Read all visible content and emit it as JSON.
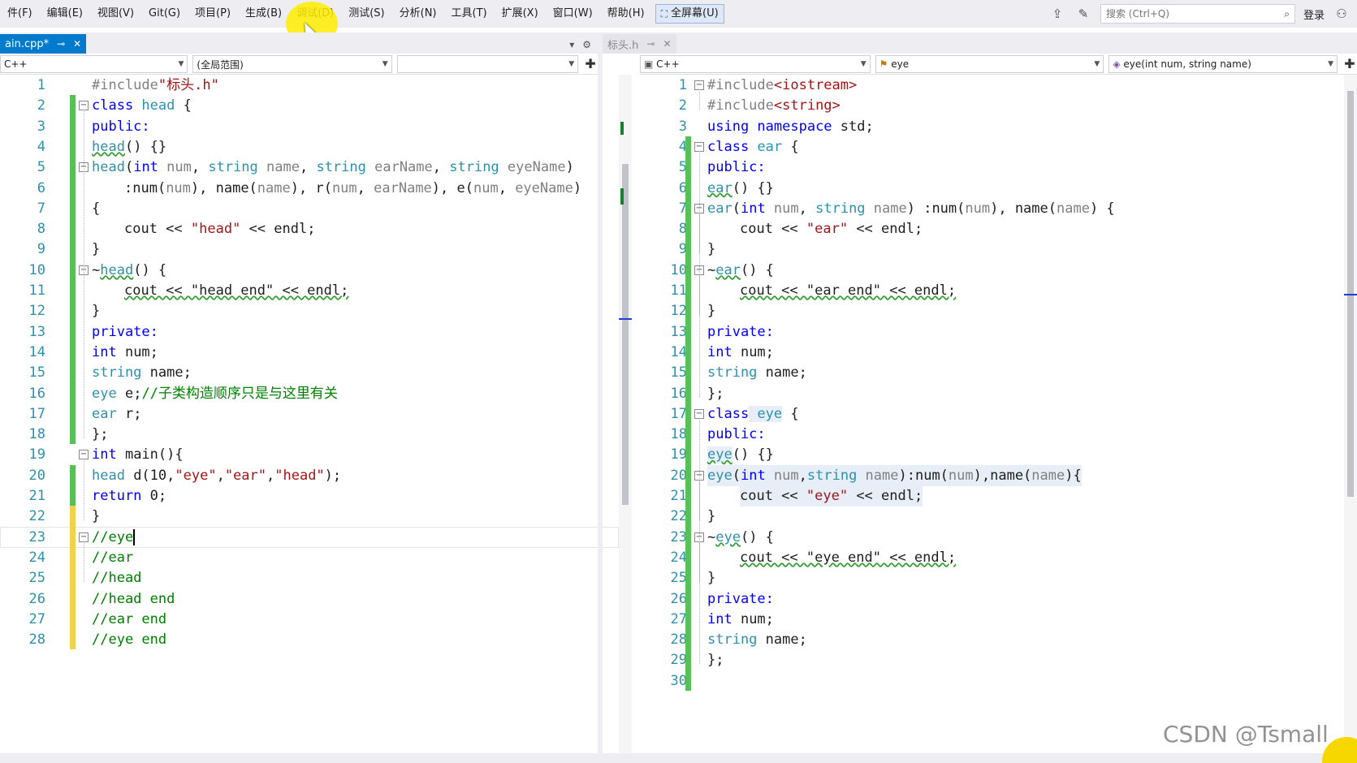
{
  "menubar": {
    "items": [
      "件(F)",
      "编辑(E)",
      "视图(V)",
      "Git(G)",
      "项目(P)",
      "生成(B)",
      "调试(D)",
      "测试(S)",
      "分析(N)",
      "工具(T)",
      "扩展(X)",
      "窗口(W)",
      "帮助(H)"
    ],
    "fullscreen": "全屏幕(U)",
    "search_placeholder": "搜索 (Ctrl+Q)",
    "login": "登录"
  },
  "left": {
    "tab": "ain.cpp*",
    "nav_lang": "C++",
    "nav_scope": "(全局范围)",
    "nav_member": ""
  },
  "right": {
    "tab": "标头.h",
    "nav_lang": "C++",
    "nav_scope": "eye",
    "nav_member": "eye(int num, string name)"
  },
  "left_lines": [
    "1",
    "2",
    "3",
    "4",
    "5",
    "6",
    "7",
    "8",
    "9",
    "10",
    "11",
    "12",
    "13",
    "14",
    "15",
    "16",
    "17",
    "18",
    "19",
    "20",
    "21",
    "22",
    "23",
    "24",
    "25",
    "26",
    "27",
    "28"
  ],
  "right_lines": [
    "1",
    "2",
    "3",
    "4",
    "5",
    "6",
    "7",
    "8",
    "9",
    "10",
    "11",
    "12",
    "13",
    "14",
    "15",
    "16",
    "17",
    "18",
    "19",
    "20",
    "21",
    "22",
    "23",
    "24",
    "25",
    "26",
    "27",
    "28",
    "29",
    "30"
  ],
  "left_code": {
    "l1a": "#include",
    "l1b": "\"标头.h\"",
    "l2a": "class",
    "l2b": " head",
    "l2c": " {",
    "l3": "public:",
    "l4a": "head",
    "l4b": "() {}",
    "l5a": "head",
    "l5b": "(",
    "l5c": "int",
    "l5d": " num",
    "l5e": ", ",
    "l5f": "string",
    "l5g": " name",
    "l5h": ", ",
    "l5i": "string",
    "l5j": " earName",
    "l5k": ", ",
    "l5l": "string",
    "l5m": " eyeName",
    "l5n": ")",
    "l6a": ":num(",
    "l6b": "num",
    "l6c": "), name(",
    "l6d": "name",
    "l6e": "), r(",
    "l6f": "num",
    "l6g": ", ",
    "l6h": "earName",
    "l6i": "), e(",
    "l6j": "num",
    "l6k": ", ",
    "l6l": "eyeName",
    "l6m": ")",
    "l7": "{",
    "l8a": "cout << ",
    "l8b": "\"head\"",
    "l8c": " << endl;",
    "l9": "}",
    "l10a": "~",
    "l10b": "head",
    "l10c": "() {",
    "l11": "cout << \"head end\" << endl;",
    "l12": "}",
    "l13": "private:",
    "l14a": "int",
    "l14b": " num;",
    "l15a": "string",
    "l15b": " name;",
    "l16a": "eye",
    "l16b": " e;",
    "l16c": "//子类构造顺序只是与这里有关",
    "l17a": "ear",
    "l17b": " r;",
    "l18": "};",
    "l19a": "int",
    "l19b": " main(){",
    "l20a": "head",
    "l20b": " d(10,",
    "l20c": "\"eye\"",
    "l20d": ",",
    "l20e": "\"ear\"",
    "l20f": ",",
    "l20g": "\"head\"",
    "l20h": ");",
    "l21a": "return",
    "l21b": " 0;",
    "l22": "}",
    "l23": "//eye",
    "l24": "//ear",
    "l25": "//head",
    "l26": "//head end",
    "l27": "//ear end",
    "l28": "//eye end"
  },
  "right_code": {
    "l1a": "#include",
    "l1b": "<iostream>",
    "l2a": "#include",
    "l2b": "<string>",
    "l3a": "using",
    "l3b": " namespace",
    "l3c": " std;",
    "l4a": "class",
    "l4b": " ear",
    "l4c": " {",
    "l5": "public:",
    "l6a": "ear",
    "l6b": "() {}",
    "l7a": "ear",
    "l7b": "(",
    "l7c": "int",
    "l7d": " num",
    "l7e": ", ",
    "l7f": "string",
    "l7g": " name",
    "l7h": ") :num(",
    "l7i": "num",
    "l7j": "), name(",
    "l7k": "name",
    "l7l": ") {",
    "l8a": "cout << ",
    "l8b": "\"ear\"",
    "l8c": " << endl;",
    "l9": "}",
    "l10a": "~",
    "l10b": "ear",
    "l10c": "() {",
    "l11": "cout << \"ear end\" << endl;",
    "l12": "}",
    "l13": "private:",
    "l14a": "int",
    "l14b": " num;",
    "l15a": "string",
    "l15b": " name;",
    "l16": "};",
    "l17a": "class",
    "l17b": " eye",
    "l17c": " {",
    "l18": "public:",
    "l19a": "eye",
    "l19b": "() {}",
    "l20a": "eye",
    "l20b": "(",
    "l20c": "int",
    "l20d": " num",
    "l20e": ",",
    "l20f": "string",
    "l20g": " name",
    "l20h": "):num(",
    "l20i": "num",
    "l20j": "),name(",
    "l20k": "name",
    "l20l": "){",
    "l21a": "cout << ",
    "l21b": "\"eye\"",
    "l21c": " << endl;",
    "l22": "}",
    "l23a": "~",
    "l23b": "eye",
    "l23c": "() {",
    "l24": "cout << \"eye end\" << endl;",
    "l25": "}",
    "l26": "private:",
    "l27a": "int",
    "l27b": " num;",
    "l28a": "string",
    "l28b": " name;",
    "l29": "};"
  },
  "watermark": "CSDN @Tsmall",
  "colors": {
    "accent": "#007acc",
    "keyword": "#0000ff",
    "type": "#2b91af",
    "string": "#a31515",
    "comment": "#008000",
    "change_saved": "#57c157",
    "change_unsaved": "#f2d24a"
  }
}
